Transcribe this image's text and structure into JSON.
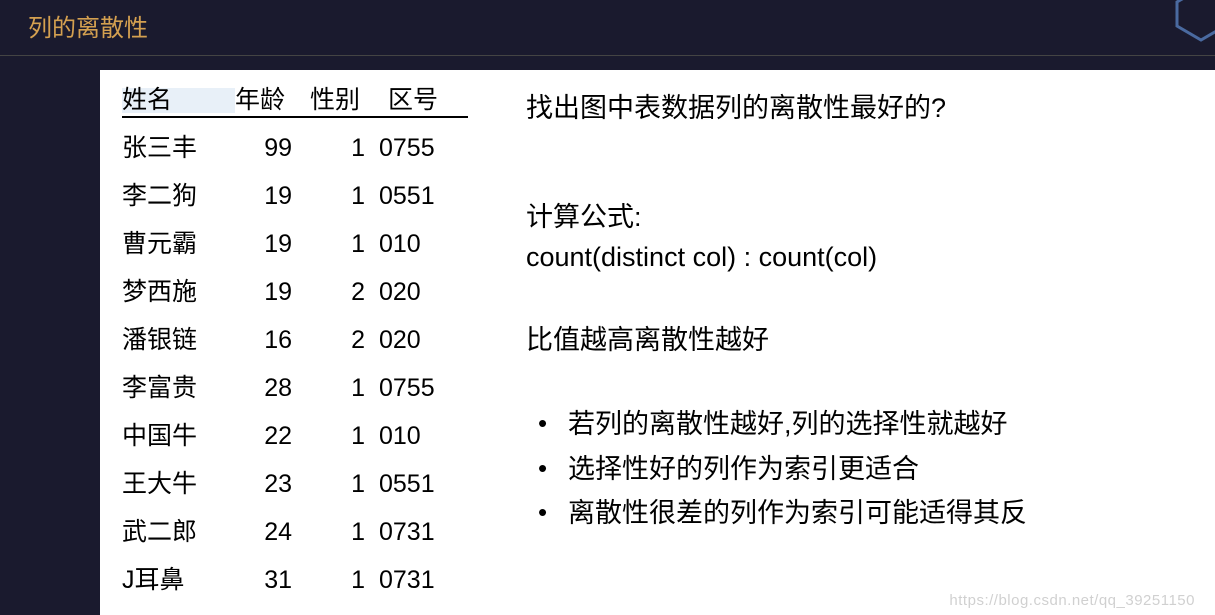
{
  "header": {
    "title": "列的离散性"
  },
  "table": {
    "headers": {
      "name": "姓名",
      "age": "年龄",
      "sex": "性别",
      "area": "区号"
    },
    "rows": [
      {
        "name": "张三丰",
        "age": "99",
        "sex": "1",
        "area": "0755"
      },
      {
        "name": "李二狗",
        "age": "19",
        "sex": "1",
        "area": "0551"
      },
      {
        "name": "曹元霸",
        "age": "19",
        "sex": "1",
        "area": "010"
      },
      {
        "name": "梦西施",
        "age": "19",
        "sex": "2",
        "area": "020"
      },
      {
        "name": "潘银链",
        "age": "16",
        "sex": "2",
        "area": "020"
      },
      {
        "name": "李富贵",
        "age": "28",
        "sex": "1",
        "area": "0755"
      },
      {
        "name": "中国牛",
        "age": "22",
        "sex": "1",
        "area": "010"
      },
      {
        "name": "王大牛",
        "age": "23",
        "sex": "1",
        "area": "0551"
      },
      {
        "name": "武二郎",
        "age": "24",
        "sex": "1",
        "area": "0731"
      },
      {
        "name": "J耳鼻",
        "age": "31",
        "sex": "1",
        "area": "0731"
      }
    ]
  },
  "right": {
    "question": "找出图中表数据列的离散性最好的?",
    "formula_label": "计算公式:",
    "formula": "count(distinct col) : count(col)",
    "ratio_line": "比值越高离散性越好",
    "bullets": [
      "若列的离散性越好,列的选择性就越好",
      "选择性好的列作为索引更适合",
      "离散性很差的列作为索引可能适得其反"
    ]
  },
  "watermark": "https://blog.csdn.net/qq_39251150"
}
